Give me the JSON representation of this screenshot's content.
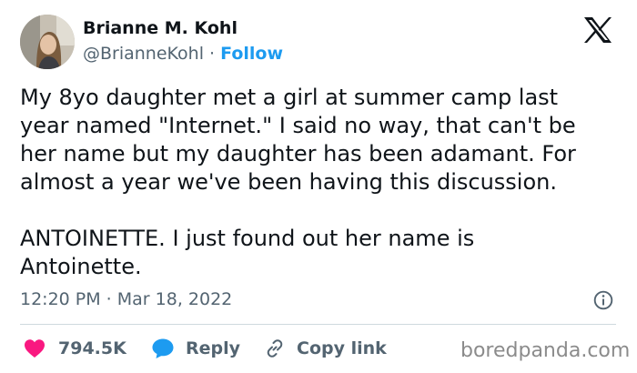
{
  "author": {
    "name": "Brianne M. Kohl",
    "handle": "@BrianneKohl",
    "separator": " · ",
    "follow_label": "Follow",
    "avatar_icon": "profile-photo",
    "platform_icon": "x-logo-icon"
  },
  "tweet": {
    "text": "My 8yo daughter met a girl at summer camp last\nyear named \"Internet.\" I said no way, that can't be\nher name but my daughter has been adamant. For\nalmost a year we've been having this discussion.\n\nANTOINETTE. I just found out her name is\nAntoinette.",
    "timestamp": "12:20 PM · Mar 18, 2022"
  },
  "actions": {
    "likes": "794.5K",
    "reply_label": "Reply",
    "copy_link_label": "Copy link"
  },
  "watermark": "boredpanda.com",
  "colors": {
    "accent": "#1d9bf0",
    "like": "#f91880",
    "text": "#0f1419",
    "muted": "#536471"
  }
}
